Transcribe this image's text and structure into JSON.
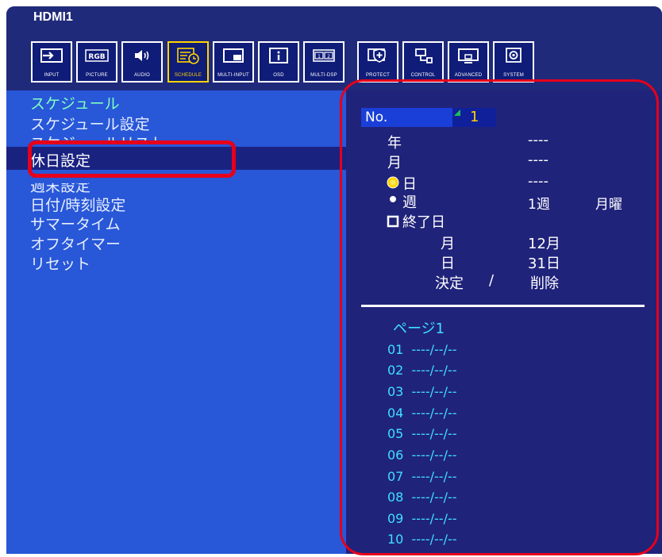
{
  "window": {
    "title": "HDMI1"
  },
  "tabs": [
    {
      "label": "INPUT",
      "icon": "input-icon"
    },
    {
      "label": "PICTURE",
      "icon": "rgb-icon"
    },
    {
      "label": "AUDIO",
      "icon": "speaker-icon"
    },
    {
      "label": "SCHEDULE",
      "icon": "schedule-icon",
      "active": true
    },
    {
      "label": "MULTI-INPUT",
      "icon": "multi-input-icon"
    },
    {
      "label": "OSD",
      "icon": "info-icon"
    },
    {
      "label": "MULTI-DSP",
      "icon": "multi-display-icon"
    },
    {
      "label": "PROTECT",
      "icon": "protect-icon"
    },
    {
      "label": "CONTROL",
      "icon": "control-icon"
    },
    {
      "label": "ADVANCED",
      "icon": "advanced-icon"
    },
    {
      "label": "SYSTEM",
      "icon": "system-icon"
    }
  ],
  "left_menu": {
    "heading": "スケジュール",
    "items": [
      "スケジュール設定",
      "スケジュールリスト",
      "休日設定",
      "週末設定",
      "日付/時刻設定",
      "サマータイム",
      "オフタイマー",
      "リセット"
    ],
    "selected_index": 2
  },
  "holiday": {
    "no_label": "No.",
    "no_value": "1",
    "year_label": "年",
    "year_value": "----",
    "month_label": "月",
    "month_value": "----",
    "day_label": "日",
    "day_value": "----",
    "week_label": "週",
    "week_value": "1週",
    "weekday_value": "月曜",
    "end_day_label": "終了日",
    "end_month_label": "月",
    "end_month_value": "12月",
    "end_day_sub_label": "日",
    "end_day_value": "31日",
    "confirm_label": "決定",
    "separator": "/",
    "delete_label": "削除"
  },
  "list": {
    "page_label": "ページ1",
    "rows": [
      {
        "no": "01",
        "date": "----/--/--"
      },
      {
        "no": "02",
        "date": "----/--/--"
      },
      {
        "no": "03",
        "date": "----/--/--"
      },
      {
        "no": "04",
        "date": "----/--/--"
      },
      {
        "no": "05",
        "date": "----/--/--"
      },
      {
        "no": "06",
        "date": "----/--/--"
      },
      {
        "no": "07",
        "date": "----/--/--"
      },
      {
        "no": "08",
        "date": "----/--/--"
      },
      {
        "no": "09",
        "date": "----/--/--"
      },
      {
        "no": "10",
        "date": "----/--/--"
      }
    ]
  },
  "colors": {
    "osd_blue": "#2857d8",
    "dark_navy": "#20237a",
    "highlight_red": "#e6001a",
    "active_yellow": "#ffd400",
    "cyan_text": "#3ee0ff"
  }
}
